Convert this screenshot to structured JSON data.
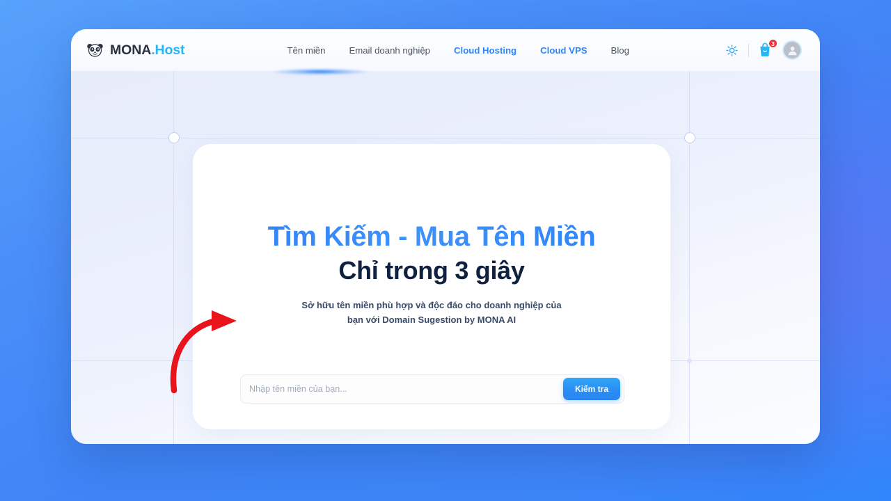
{
  "brand": {
    "logo_icon": "panda-icon",
    "name_primary": "MONA",
    "name_accent": ".Host"
  },
  "header": {
    "nav": [
      {
        "label": "Tên miền",
        "active": false
      },
      {
        "label": "Email doanh nghiệp",
        "active": false
      },
      {
        "label": "Cloud Hosting",
        "active": true
      },
      {
        "label": "Cloud VPS",
        "active": true
      },
      {
        "label": "Blog",
        "active": false
      }
    ],
    "actions": {
      "theme_toggle_icon": "sun-icon",
      "cart_icon": "shopping-bag-icon",
      "cart_badge_count": "3",
      "avatar_icon": "user-avatar-icon"
    }
  },
  "hero": {
    "title_line1": "Tìm Kiếm - Mua Tên Miền",
    "title_line2": "Chỉ trong 3 giây",
    "subtitle_line1": "Sở hữu tên miền phù hợp và độc đáo cho doanh nghiệp của",
    "subtitle_line2": "bạn với Domain Sugestion by MONA AI"
  },
  "search": {
    "placeholder": "Nhập tên miền của bạn...",
    "value": "",
    "button_label": "Kiểm tra"
  },
  "annotation": {
    "arrow_icon": "red-curved-arrow-icon",
    "arrow_color": "#e8131b",
    "points_to": "search-input"
  },
  "colors": {
    "page_background_blue": "#3f85f7",
    "brand_accent": "#29b6f6",
    "nav_active": "#2f86f6",
    "title_gradient_blue": "#2f7ef2",
    "title_dark": "#10213f",
    "button_blue": "#2a86f3",
    "badge_red": "#f0303b"
  }
}
